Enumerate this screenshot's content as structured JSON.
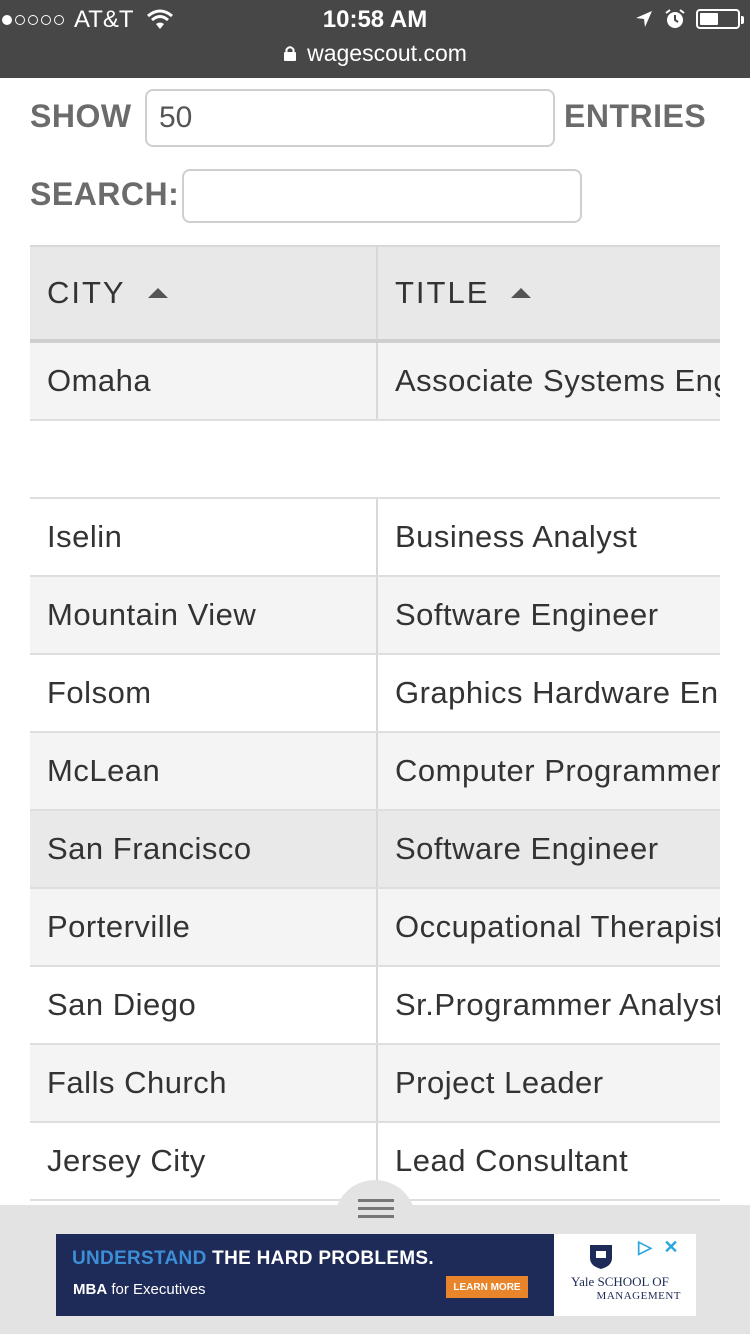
{
  "status_bar": {
    "carrier": "AT&T",
    "time": "10:58 AM",
    "url": "wagescout.com"
  },
  "controls": {
    "show_label": "SHOW",
    "show_value": "50",
    "entries_label": "ENTRIES",
    "search_label": "SEARCH:",
    "search_value": ""
  },
  "table": {
    "columns": [
      "CITY",
      "TITLE"
    ],
    "rows": [
      {
        "city": "Omaha",
        "title": "Associate Systems Engineer"
      },
      {
        "city": "",
        "title": ""
      },
      {
        "city": "Iselin",
        "title": "Business Analyst"
      },
      {
        "city": "Mountain View",
        "title": "Software Engineer"
      },
      {
        "city": "Folsom",
        "title": "Graphics Hardware Engineer"
      },
      {
        "city": "McLean",
        "title": "Computer Programmer"
      },
      {
        "city": "San Francisco",
        "title": "Software Engineer"
      },
      {
        "city": "Porterville",
        "title": "Occupational Therapist"
      },
      {
        "city": "San Diego",
        "title": "Sr.Programmer Analyst"
      },
      {
        "city": "Falls Church",
        "title": "Project Leader"
      },
      {
        "city": "Jersey City",
        "title": "Lead Consultant"
      }
    ]
  },
  "ad": {
    "headline_highlight": "UNDERSTAND",
    "headline_rest": " THE HARD PROBLEMS.",
    "sub_bold": "MBA",
    "sub_rest": " for Executives",
    "button": "LEARN MORE",
    "yale_line1": "Yale SCHOOL OF",
    "yale_line2": "MANAGEMENT"
  },
  "colors": {
    "status_bar_bg": "#474747",
    "header_bg": "#e8e8e8",
    "ad_bg": "#1e2a57",
    "ad_accent": "#3c8fd6",
    "ad_button": "#e8842a"
  }
}
